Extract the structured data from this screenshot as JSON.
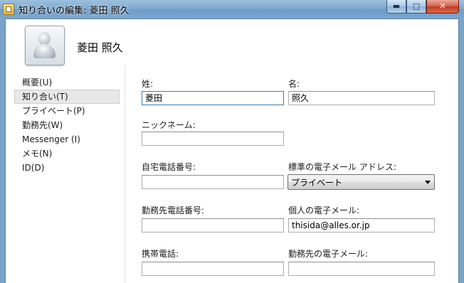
{
  "window": {
    "title": "知り合いの編集: 菱田 照久",
    "caption_buttons": {
      "minimize": "▬",
      "maximize": "□",
      "close": "✕"
    }
  },
  "contact": {
    "name": "菱田 照久",
    "avatar_icon": "person-silhouette-icon"
  },
  "nav": {
    "selected_index": 1,
    "items": [
      {
        "label": "概要(U)"
      },
      {
        "label": "知り合い(T)"
      },
      {
        "label": "プライベート(P)"
      },
      {
        "label": "勤務先(W)"
      },
      {
        "label": "Messenger (I)"
      },
      {
        "label": "メモ(N)"
      },
      {
        "label": "ID(D)"
      }
    ]
  },
  "form": {
    "last_name": {
      "label": "姓:",
      "value": "菱田"
    },
    "first_name": {
      "label": "名:",
      "value": "照久"
    },
    "nickname": {
      "label": "ニックネーム:",
      "value": ""
    },
    "home_phone": {
      "label": "自宅電話番号:",
      "value": ""
    },
    "default_email": {
      "label": "標準の電子メール アドレス:",
      "selected": "プライベート"
    },
    "work_phone": {
      "label": "勤務先電話番号:",
      "value": ""
    },
    "personal_email": {
      "label": "個人の電子メール:",
      "value": "thisida@alles.or.jp"
    },
    "mobile_phone": {
      "label": "携帯電話:",
      "value": ""
    },
    "work_email": {
      "label": "勤務先の電子メール:",
      "value": ""
    }
  }
}
